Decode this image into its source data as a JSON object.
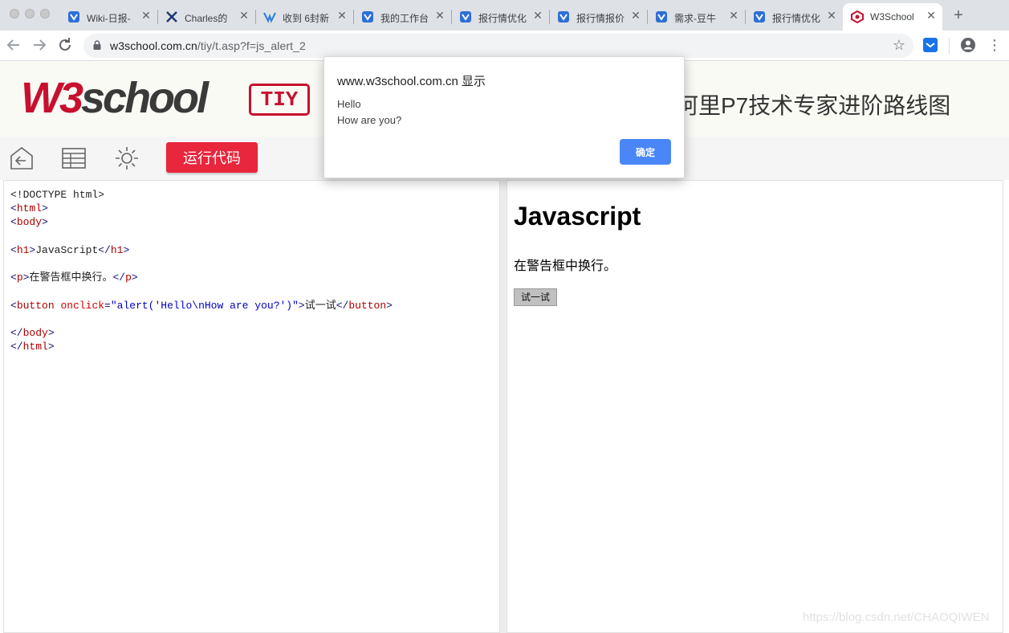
{
  "browser": {
    "tabs": [
      {
        "title": "Wiki-日报-",
        "favicon": "confluence-icon",
        "active": false
      },
      {
        "title": "Charles的",
        "favicon": "charles-icon",
        "active": false
      },
      {
        "title": "收到 6封新",
        "favicon": "mail-icon",
        "active": false
      },
      {
        "title": "我的工作台",
        "favicon": "confluence-icon",
        "active": false
      },
      {
        "title": "报行情优化",
        "favicon": "confluence-icon",
        "active": false
      },
      {
        "title": "报行情报价",
        "favicon": "confluence-icon",
        "active": false
      },
      {
        "title": "需求-豆牛",
        "favicon": "confluence-icon",
        "active": false
      },
      {
        "title": "报行情优化",
        "favicon": "confluence-icon",
        "active": false
      },
      {
        "title": "W3School",
        "favicon": "w3school-icon",
        "active": true
      }
    ],
    "close_glyph": "✕",
    "new_tab_glyph": "+",
    "url_host": "w3school.com.cn",
    "url_path": "/tiy/t.asp?f=js_alert_2"
  },
  "header": {
    "logo_w3": "W3",
    "logo_school": "school",
    "tiy_badge": "TIY",
    "promo": "阿里P7技术专家进阶路线图"
  },
  "controls": {
    "run_label": "运行代码"
  },
  "code": {
    "doctype": "<!DOCTYPE html>",
    "h1_text": "JavaScript",
    "p_text": "在警告框中换行。",
    "onclick_value": "\"alert('Hello\\nHow are you?')\"",
    "button_text": "试一试"
  },
  "preview": {
    "heading": "Javascript",
    "paragraph": "在警告框中换行。",
    "button_label": "试一试"
  },
  "dialog": {
    "origin": "www.w3school.com.cn 显示",
    "line1": "Hello",
    "line2": "How are you?",
    "ok_label": "确定"
  },
  "watermark": "https://blog.csdn.net/CHAOQIWEN",
  "colors": {
    "accent_red": "#e8263c",
    "dialog_button": "#4a86f7"
  }
}
